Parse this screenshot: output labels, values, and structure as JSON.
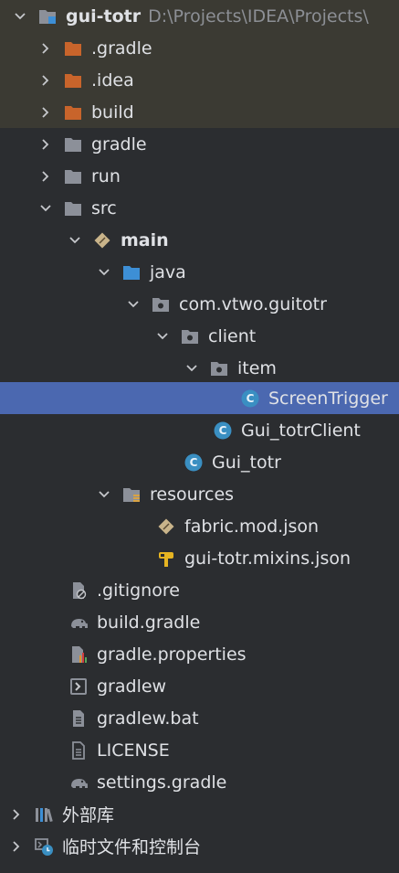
{
  "colors": {
    "folder_excluded": "#c8642b",
    "folder_normal": "#8c9099",
    "folder_source": "#3d8fd6",
    "class_icon": "#3a8fc2",
    "selection": "#4b68b0",
    "excluded_bg": "#3b3a33"
  },
  "project": {
    "name": "gui-totr",
    "path": "D:\\Projects\\IDEA\\Projects\\"
  },
  "nodes": [
    {
      "label": "gui-totr",
      "icon": "module-folder-icon",
      "expanded": true
    },
    {
      "label": ".gradle",
      "icon": "folder-excluded-icon",
      "expanded": false
    },
    {
      "label": ".idea",
      "icon": "folder-excluded-icon",
      "expanded": false
    },
    {
      "label": "build",
      "icon": "folder-excluded-icon",
      "expanded": false
    },
    {
      "label": "gradle",
      "icon": "folder-icon",
      "expanded": false
    },
    {
      "label": "run",
      "icon": "folder-icon",
      "expanded": false
    },
    {
      "label": "src",
      "icon": "folder-icon",
      "expanded": true
    },
    {
      "label": "main",
      "icon": "source-set-icon",
      "expanded": true
    },
    {
      "label": "java",
      "icon": "source-root-folder-icon",
      "expanded": true
    },
    {
      "label": "com.vtwo.guitotr",
      "icon": "package-icon",
      "expanded": true
    },
    {
      "label": "client",
      "icon": "package-icon",
      "expanded": true
    },
    {
      "label": "item",
      "icon": "package-icon",
      "expanded": true
    },
    {
      "label": "ScreenTrigger",
      "icon": "class-icon"
    },
    {
      "label": "Gui_totrClient",
      "icon": "class-icon"
    },
    {
      "label": "Gui_totr",
      "icon": "class-icon"
    },
    {
      "label": "resources",
      "icon": "resources-folder-icon",
      "expanded": true
    },
    {
      "label": "fabric.mod.json",
      "icon": "json-file-icon"
    },
    {
      "label": "gui-totr.mixins.json",
      "icon": "mixin-json-icon"
    },
    {
      "label": ".gitignore",
      "icon": "gitignore-file-icon"
    },
    {
      "label": "build.gradle",
      "icon": "gradle-elephant-icon"
    },
    {
      "label": "gradle.properties",
      "icon": "properties-file-icon"
    },
    {
      "label": "gradlew",
      "icon": "shell-script-icon"
    },
    {
      "label": "gradlew.bat",
      "icon": "text-file-icon"
    },
    {
      "label": "LICENSE",
      "icon": "license-file-icon"
    },
    {
      "label": "settings.gradle",
      "icon": "gradle-elephant-icon"
    },
    {
      "label": "外部库",
      "icon": "external-libraries-icon",
      "expanded": false
    },
    {
      "label": "临时文件和控制台",
      "icon": "scratches-icon",
      "expanded": false
    }
  ]
}
